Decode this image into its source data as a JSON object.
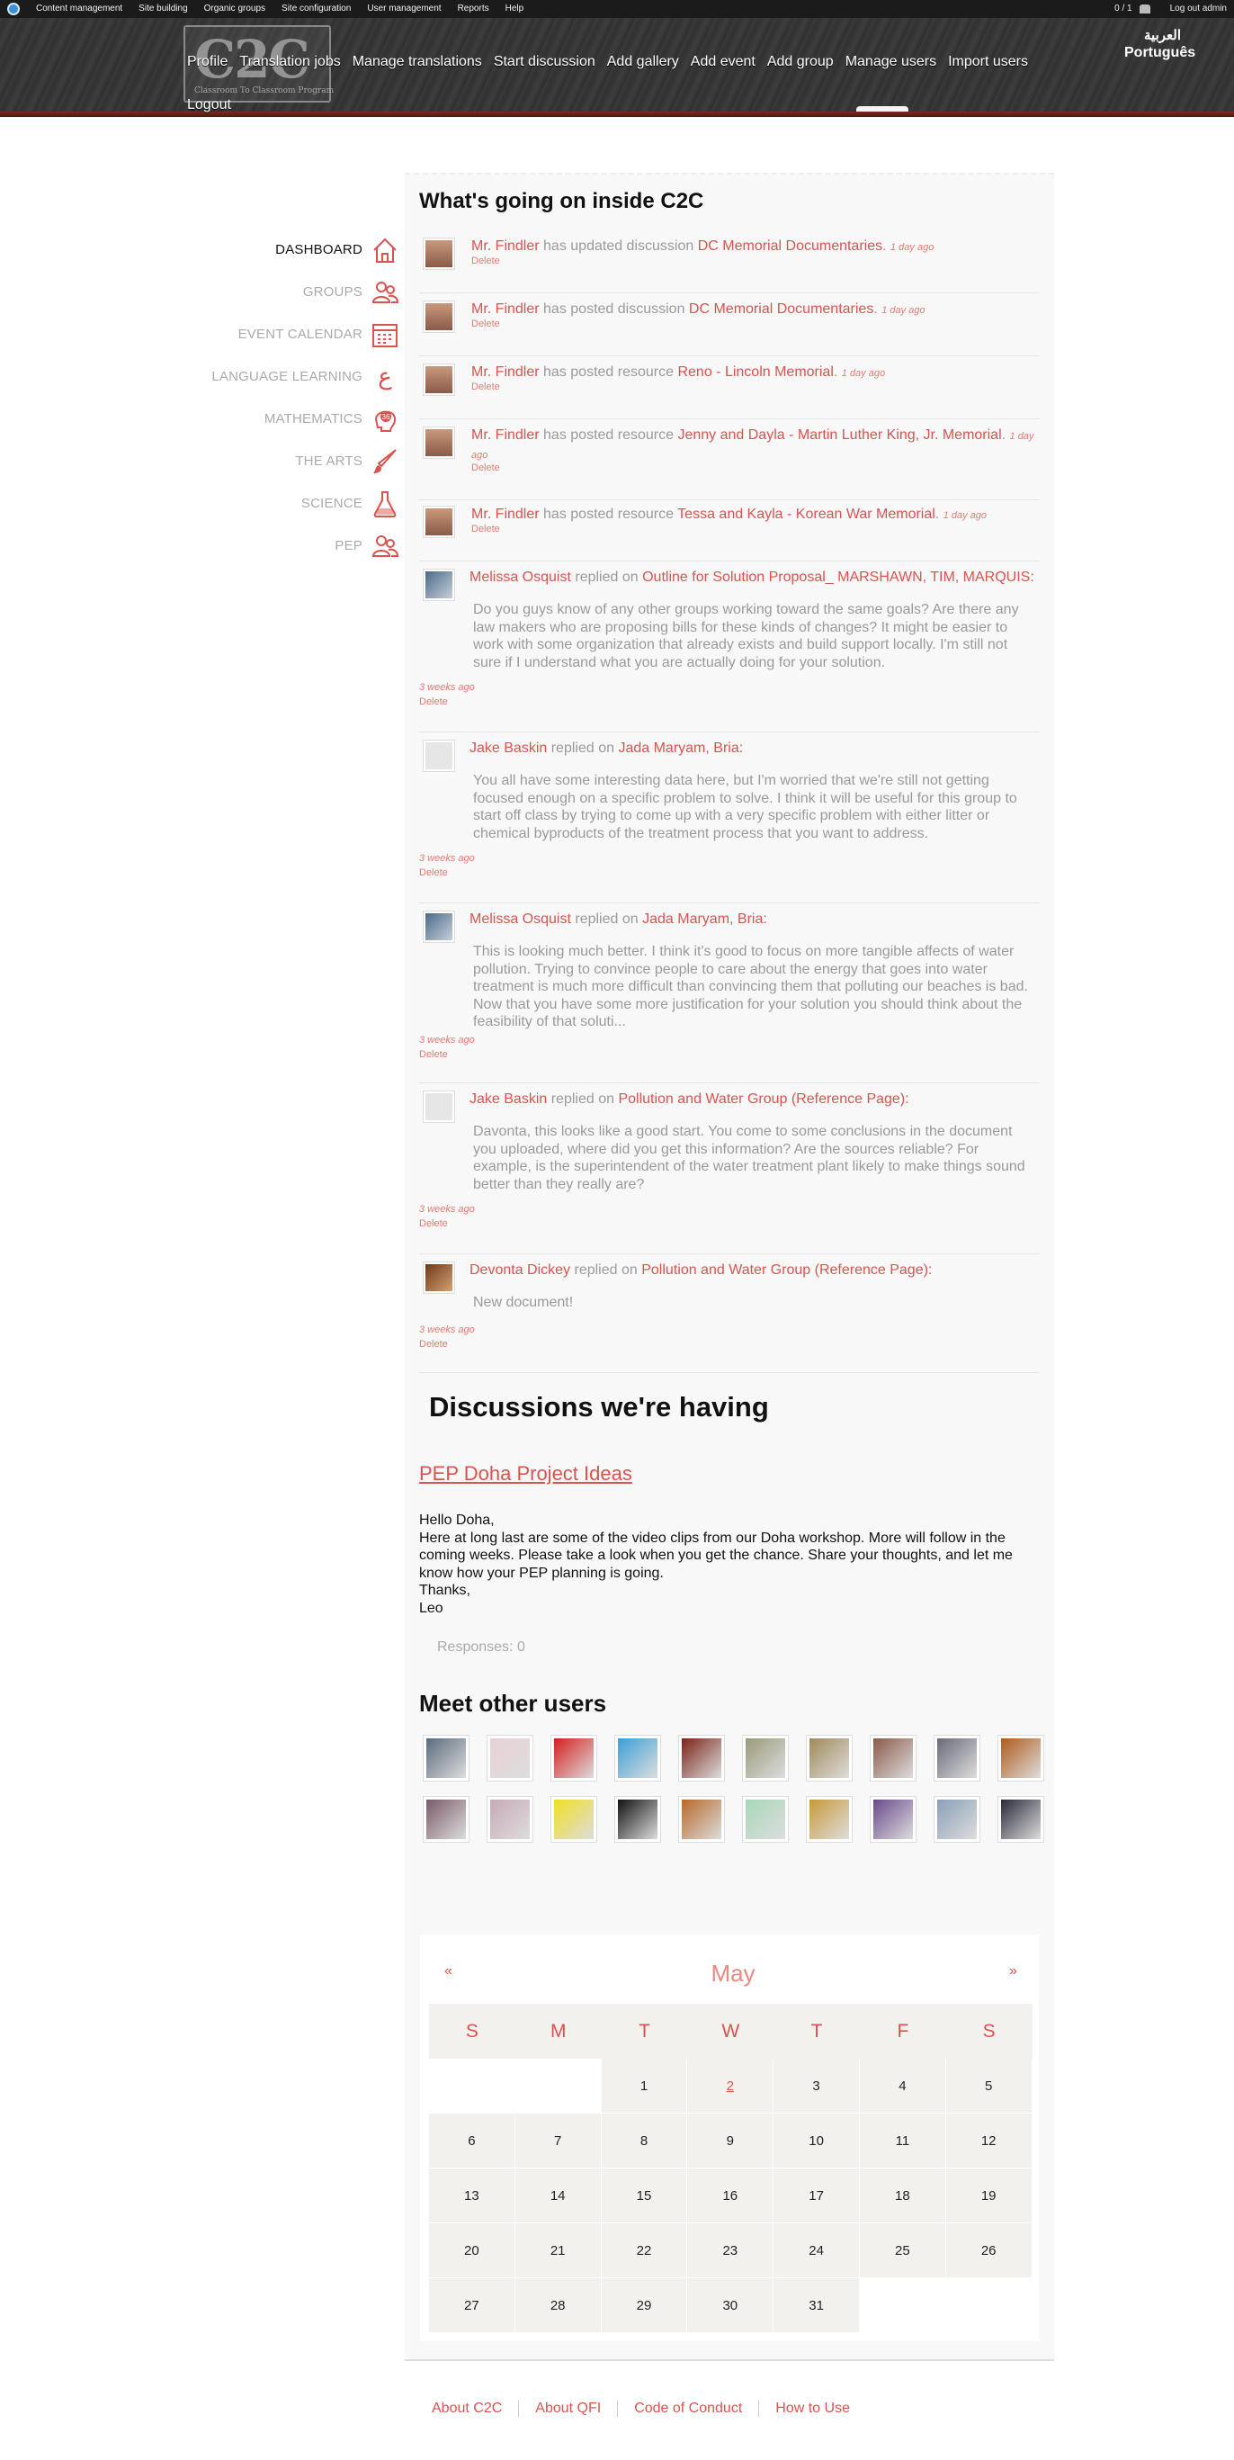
{
  "admin_bar": {
    "menu": [
      "Content management",
      "Site building",
      "Organic groups",
      "Site configuration",
      "User management",
      "Reports",
      "Help"
    ],
    "user_count": "0 / 1",
    "logout": "Log out admin"
  },
  "header": {
    "logo_text": "C2C",
    "logo_subtitle": "Classroom To Classroom Program",
    "nav": [
      "Profile",
      "Translation jobs",
      "Manage translations",
      "Start discussion",
      "Add gallery",
      "Add event",
      "Add group",
      "Manage users",
      "Import users"
    ],
    "logout": "Logout",
    "lang_arabic": "العربية",
    "lang_portuguese": "Português"
  },
  "sidebar": {
    "items": [
      {
        "label": "DASHBOARD",
        "icon": "house-icon"
      },
      {
        "label": "GROUPS",
        "icon": "people-icon"
      },
      {
        "label": "EVENT CALENDAR",
        "icon": "calendar-icon"
      },
      {
        "label": "LANGUAGE LEARNING",
        "icon": "arabic-letter-icon"
      },
      {
        "label": "MATHEMATICS",
        "icon": "math-head-icon"
      },
      {
        "label": "THE ARTS",
        "icon": "paintbrush-icon"
      },
      {
        "label": "SCIENCE",
        "icon": "flask-icon"
      },
      {
        "label": "PEP",
        "icon": "people-icon"
      }
    ]
  },
  "activity": {
    "title": "What's going on inside C2C",
    "delete_label": "Delete",
    "items": [
      {
        "who": "Mr. Findler",
        "verb": "has updated discussion",
        "what": "DC Memorial Documentaries",
        "when": "1 day ago"
      },
      {
        "who": "Mr. Findler",
        "verb": "has posted discussion",
        "what": "DC Memorial Documentaries",
        "when": "1 day ago"
      },
      {
        "who": "Mr. Findler",
        "verb": "has posted resource",
        "what": "Reno - Lincoln Memorial",
        "when": "1 day ago"
      },
      {
        "who": "Mr. Findler",
        "verb": "has posted resource",
        "what": "Jenny and Dayla - Martin Luther King, Jr. Memorial",
        "when": "1 day ago"
      },
      {
        "who": "Mr. Findler",
        "verb": "has posted resource",
        "what": "Tessa and Kayla - Korean War Memorial",
        "when": "1 day ago"
      }
    ],
    "replies": [
      {
        "who": "Melissa Osquist",
        "verb": "replied on",
        "what": "Outline for Solution Proposal_ MARSHAWN, TIM, MARQUIS:",
        "quote": "Do you guys know of any other groups working toward the same goals?  Are there any law makers who are proposing bills for these kinds of changes?  It might be easier to work with some organization that already exists and build support locally.  I'm still not sure if I understand what you are actually doing for your solution.",
        "when": "3 weeks ago"
      },
      {
        "who": "Jake Baskin",
        "verb": "replied on",
        "what": "Jada Maryam, Bria:",
        "quote": "You all have some interesting data here, but I'm worried that we're still not getting focused enough on a specific problem to solve. I think it will be useful for this group to start off class by trying to come up with a very specific problem with either litter or chemical byproducts of the treatment process that you want to address.",
        "when": "3 weeks ago"
      },
      {
        "who": "Melissa Osquist",
        "verb": "replied on",
        "what": "Jada Maryam, Bria:",
        "quote": "This is looking much better.  I think it's good to focus on more tangible affects of water pollution.  Trying to convince people to care about the energy that goes into water treatment is much more difficult than convincing them that polluting our beaches is bad.  Now that you have some more justification for your solution you should think about the feasibility of that soluti...",
        "when": "3 weeks ago"
      },
      {
        "who": "Jake Baskin",
        "verb": "replied on",
        "what": "Pollution and Water Group (Reference Page):",
        "quote": "Davonta, this looks like a good start. You come to some conclusions in the document you uploaded, where did you get this information? Are the sources reliable? For example, is the superintendent of the water treatment plant likely to make things sound better than they really are?",
        "when": "3 weeks ago"
      },
      {
        "who": "Devonta Dickey",
        "verb": "replied on",
        "what": "Pollution and Water Group (Reference Page):",
        "quote": "New document!",
        "when": "3 weeks ago"
      }
    ]
  },
  "discussions": {
    "title": "Discussions we're having",
    "link": "PEP Doha Project Ideas",
    "body": [
      "Hello Doha,",
      "Here at long last are some of the video clips from our Doha workshop. More will follow in the coming weeks. Please take a look when you get the chance. Share your thoughts, and let me know how your PEP planning is going.",
      "Thanks,",
      "Leo"
    ],
    "responses": "Responses: 0"
  },
  "users": {
    "title": "Meet other users",
    "avatar_colors": [
      "#5a6b7d",
      "#e8d2d6",
      "#d61e1e",
      "#3aa0d8",
      "#7a2418",
      "#9a9a7a",
      "#a08a5a",
      "#8a5a4a",
      "#6a6a7a",
      "#b05a1a",
      "#7a5a6a",
      "#c8a8b8",
      "#f0e020",
      "#111111",
      "#b86a2a",
      "#a8d8b8",
      "#c89a3a",
      "#6a4a8a",
      "#8aa0b8",
      "#2a2a3a"
    ]
  },
  "calendar": {
    "month": "May",
    "prev": "«",
    "next": "»",
    "weekdays": [
      "S",
      "M",
      "T",
      "W",
      "T",
      "F",
      "S"
    ],
    "days": [
      "",
      "",
      "1",
      "2",
      "3",
      "4",
      "5",
      "6",
      "7",
      "8",
      "9",
      "10",
      "11",
      "12",
      "13",
      "14",
      "15",
      "16",
      "17",
      "18",
      "19",
      "20",
      "21",
      "22",
      "23",
      "24",
      "25",
      "26",
      "27",
      "28",
      "29",
      "30",
      "31",
      "",
      ""
    ],
    "linked_day": "2"
  },
  "footer": {
    "links": [
      "About C2C",
      "About QFI",
      "Code of Conduct",
      "How to Use"
    ]
  },
  "colors": {
    "accent": "#d9534f",
    "header": "#333333"
  }
}
